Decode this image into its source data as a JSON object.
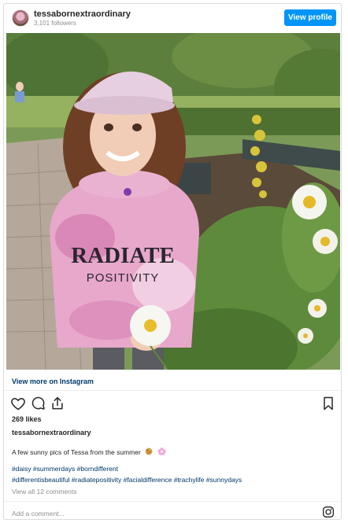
{
  "header": {
    "username": "tessabornextraordinary",
    "followers": "3,101 followers",
    "view_profile_label": "View profile"
  },
  "photo": {
    "hoodie_text_line1": "RADIATE",
    "hoodie_text_line2": "POSITIVITY"
  },
  "view_more_label": "View more on Instagram",
  "actions": {
    "like_icon": "heart-icon",
    "comment_icon": "comment-icon",
    "share_icon": "share-icon",
    "save_icon": "bookmark-icon"
  },
  "likes": "269 likes",
  "caption": {
    "username": "tessabornextraordinary",
    "text": "A few sunny pics of Tessa from the summer",
    "emojis": [
      "cookie",
      "flower"
    ]
  },
  "hashtags_line1": "#daisy #summerdays #borndifferent",
  "hashtags_line2": "#differentisbeautiful #radiatepositivity #facialdifference #trachylife #sunnydays",
  "comments_link": "View all 12 comments",
  "add_comment_placeholder": "Add a comment...",
  "colors": {
    "accent": "#0095f6",
    "link": "#00376b",
    "muted": "#8e8e8e"
  }
}
